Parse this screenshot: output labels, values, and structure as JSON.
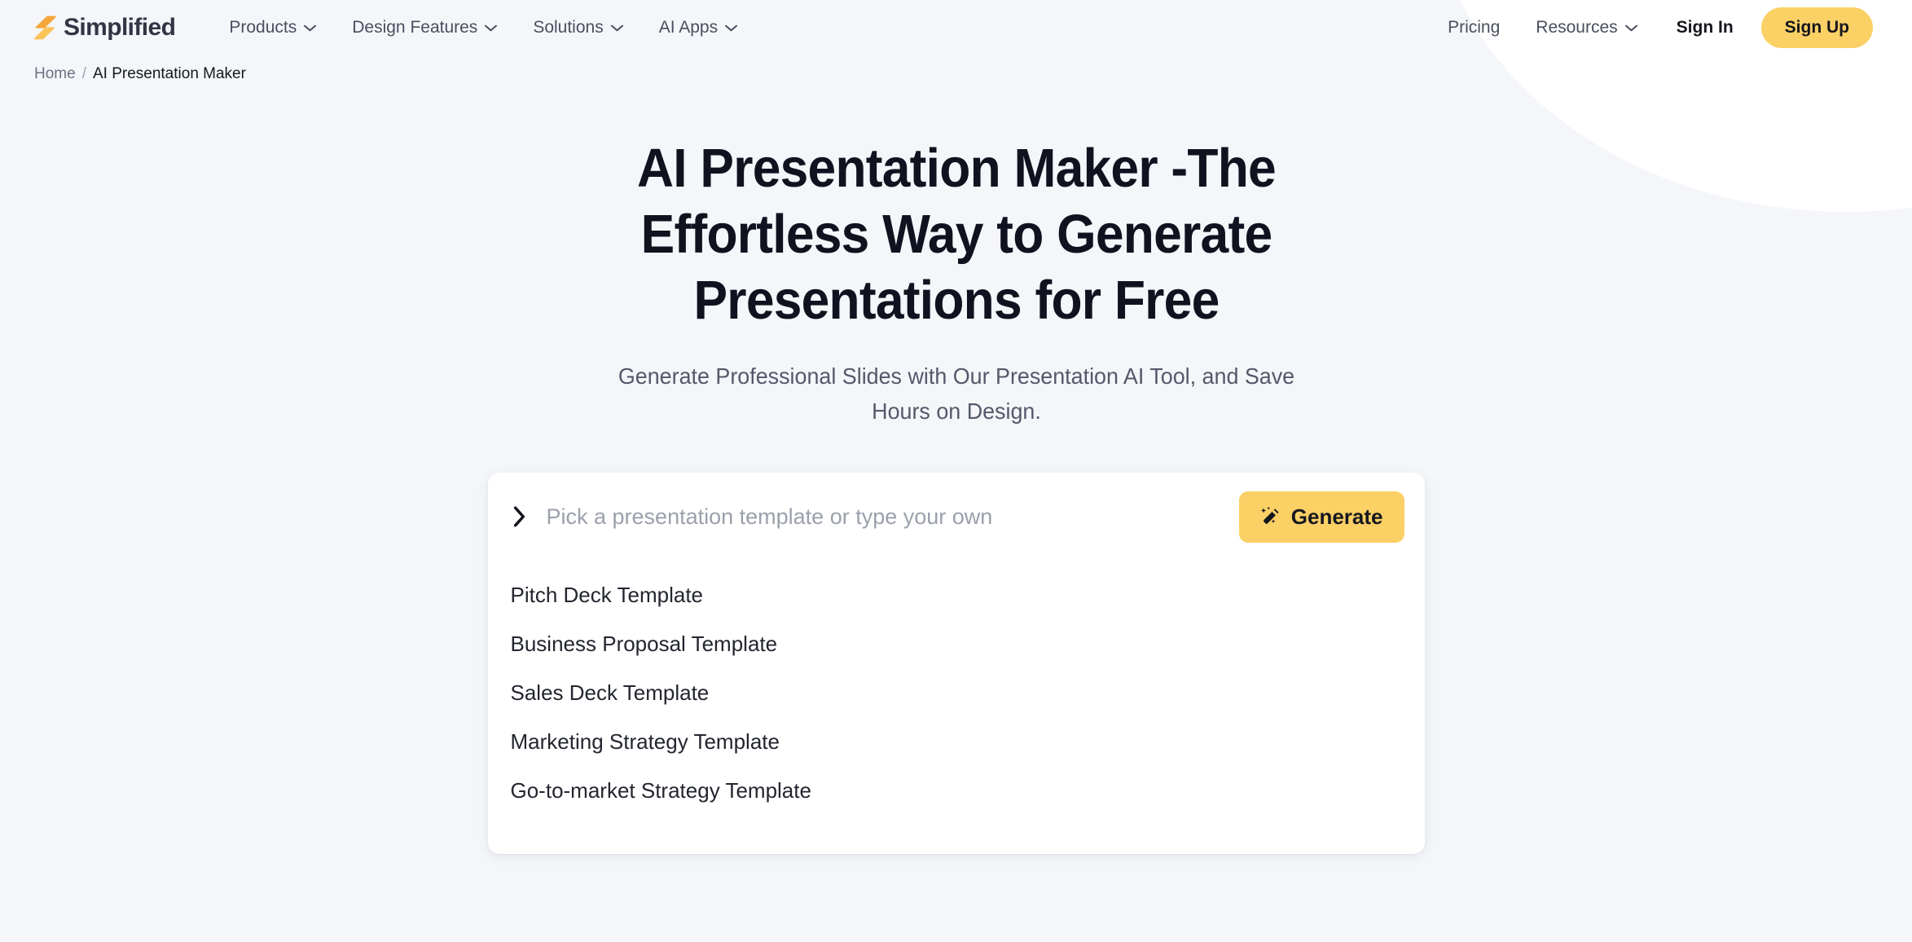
{
  "theme": {
    "page_bg": "#f4f6fa",
    "card_bg": "#ffffff",
    "accent_yellow": "#fbd065",
    "heading_color": "#10121f",
    "muted_text": "#54596a"
  },
  "navbar": {
    "brand_name": "Simplified",
    "brand_icon": "simplified-bolt-logo",
    "links": [
      {
        "label": "Products",
        "icon": "chevron-down-icon"
      },
      {
        "label": "Design Features",
        "icon": "chevron-down-icon"
      },
      {
        "label": "Solutions",
        "icon": "chevron-down-icon"
      },
      {
        "label": "AI Apps",
        "icon": "chevron-down-icon"
      }
    ],
    "right_links": [
      {
        "label": "Pricing",
        "icon": ""
      },
      {
        "label": "Resources",
        "icon": "chevron-down-icon"
      }
    ],
    "sign_in_label": "Sign In",
    "sign_up_label": "Sign Up"
  },
  "breadcrumb": {
    "home_label": "Home",
    "separator": "/",
    "current_label": "AI Presentation Maker"
  },
  "hero": {
    "title": "AI Presentation Maker -The Effortless Way to Generate Presentations for Free",
    "subtitle": "Generate Professional Slides with Our Presentation AI Tool, and Save Hours on Design."
  },
  "picker": {
    "chevron_icon": "chevron-right-icon",
    "input_value": "",
    "input_placeholder": "Pick a presentation template or type your own",
    "generate_label": "Generate",
    "generate_icon": "magic-wand-icon",
    "templates": [
      {
        "label": "Pitch Deck Template"
      },
      {
        "label": "Business Proposal Template"
      },
      {
        "label": "Sales Deck Template"
      },
      {
        "label": "Marketing Strategy Template"
      },
      {
        "label": "Go-to-market Strategy Template"
      }
    ]
  }
}
